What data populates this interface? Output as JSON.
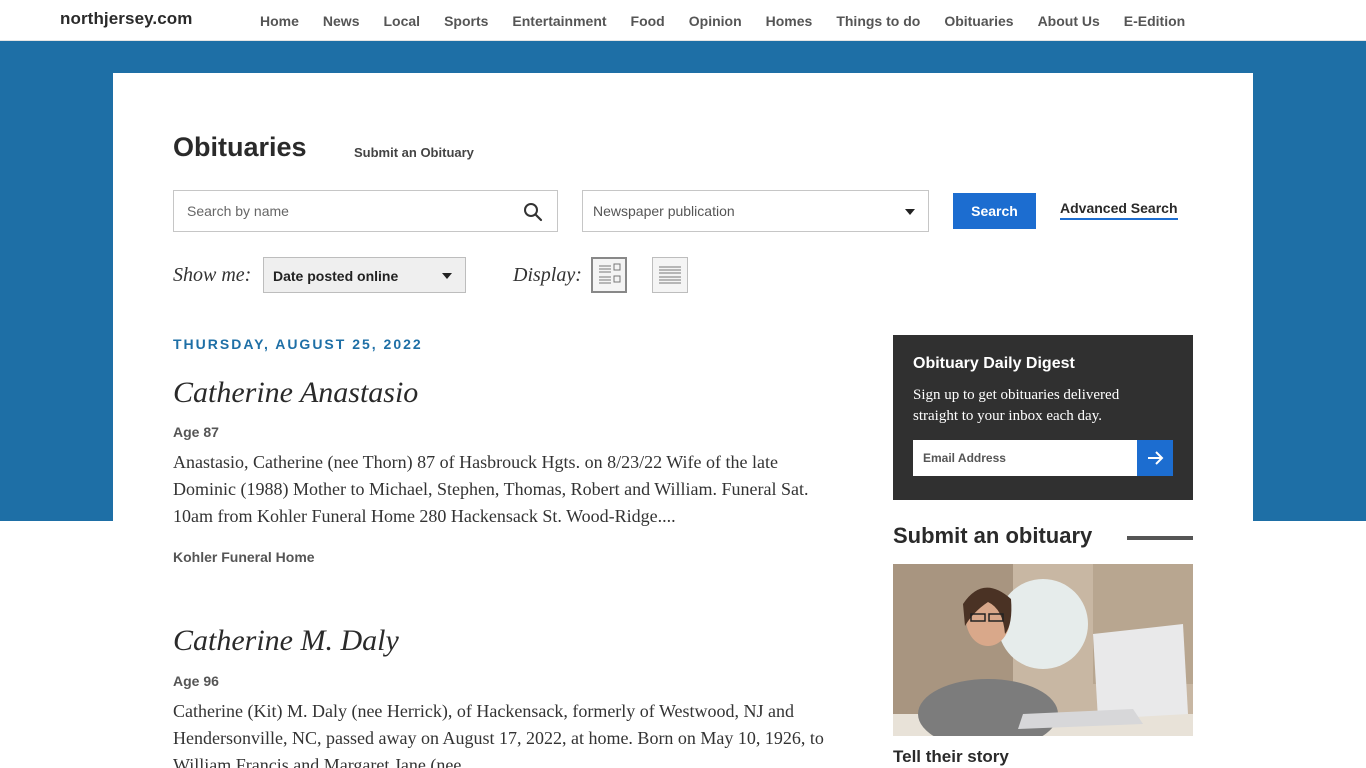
{
  "site": {
    "logo": "northjersey.com",
    "nav": [
      "Home",
      "News",
      "Local",
      "Sports",
      "Entertainment",
      "Food",
      "Opinion",
      "Homes",
      "Things to do",
      "Obituaries",
      "About Us",
      "E-Edition"
    ]
  },
  "header": {
    "title": "Obituaries",
    "submit_link": "Submit an Obituary"
  },
  "search": {
    "name_placeholder": "Search by name",
    "publication_label": "Newspaper publication",
    "button_label": "Search",
    "advanced_label": "Advanced Search"
  },
  "filters": {
    "show_me_label": "Show me:",
    "show_me_value": "Date posted online",
    "display_label": "Display:"
  },
  "listing": {
    "date_heading": "THURSDAY, AUGUST 25, 2022",
    "obituaries": [
      {
        "name": "Catherine Anastasio",
        "age": "Age 87",
        "text": "Anastasio, Catherine (nee Thorn) 87 of Hasbrouck Hgts. on 8/23/22 Wife of the late Dominic (1988) Mother to Michael, Stephen, Thomas, Robert and William. Funeral Sat. 10am from Kohler Funeral Home 280 Hackensack St. Wood-Ridge....",
        "funeral_home": "Kohler Funeral Home"
      },
      {
        "name": "Catherine M. Daly",
        "age": "Age 96",
        "text": "Catherine (Kit) M. Daly (nee Herrick), of Hackensack, formerly of Westwood, NJ and Hendersonville, NC, passed away on August 17, 2022, at home. Born on May 10, 1926, to William Francis and Margaret Jane (nee",
        "funeral_home": ""
      }
    ]
  },
  "sidebar": {
    "digest_title": "Obituary Daily Digest",
    "digest_text": "Sign up to get obituaries delivered straight to your inbox each day.",
    "email_placeholder": "Email Address",
    "submit_heading": "Submit an obituary",
    "tell_story": "Tell their story"
  },
  "colors": {
    "brand_blue": "#1e6fa6",
    "button_blue": "#1c6dd0",
    "digest_bg": "#303030"
  }
}
